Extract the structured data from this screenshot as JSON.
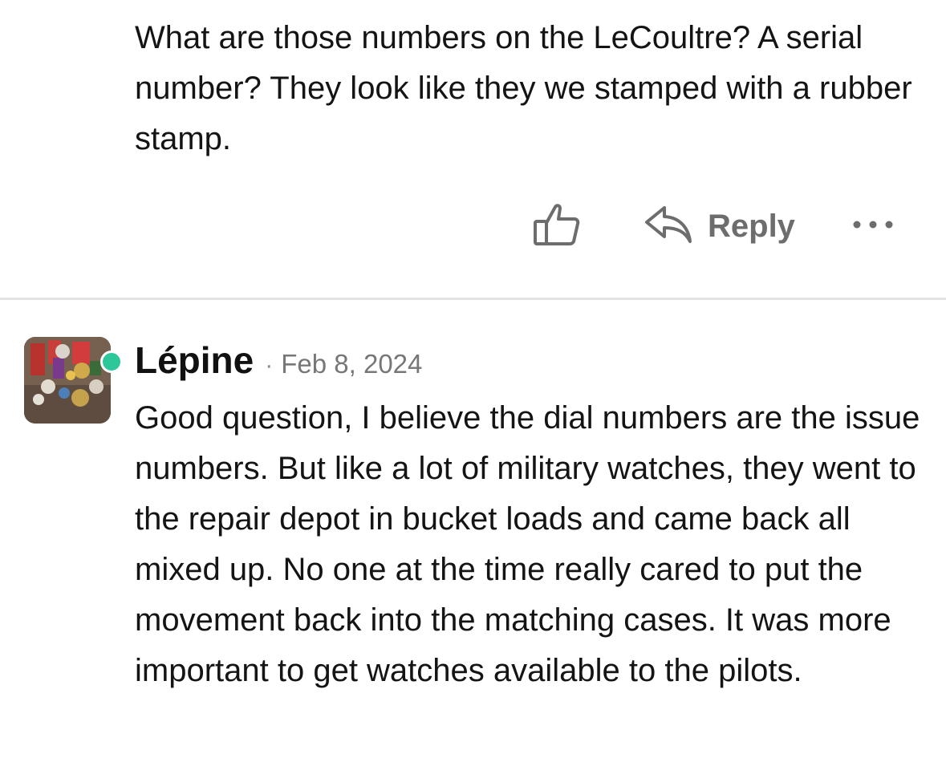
{
  "previous_comment": {
    "text": "What are those numbers on the LeCoultre? A serial number? They look like they we stamped with a rubber stamp.",
    "actions": {
      "like_icon": "thumbs-up-icon",
      "reply_icon": "reply-arrow-icon",
      "reply_label": "Reply",
      "more_icon": "ellipsis-icon"
    }
  },
  "comment": {
    "author": "Lépine",
    "separator": "·",
    "date": "Feb 8, 2024",
    "online": true,
    "online_color": "#2ec79a",
    "text": "Good question, I believe the dial numbers are the issue numbers. But like a lot of military watches, they went to the repair depot in bucket loads and came back all mixed up. No one at the time really cared to put the movement back into the matching cases. It was more important to get watches available to the pilots."
  },
  "colors": {
    "text": "#141414",
    "muted": "#6d6d6d",
    "divider": "#e3e3e3"
  }
}
